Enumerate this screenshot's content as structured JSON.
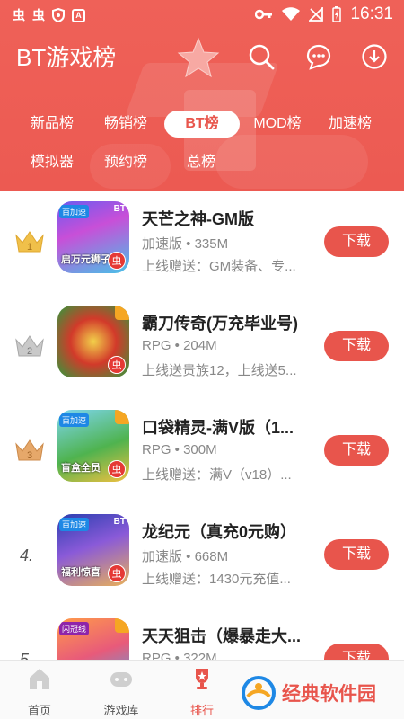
{
  "status_bar": {
    "time": "16:31",
    "left_glyphs": [
      "虫",
      "虫"
    ]
  },
  "header": {
    "title": "BT游戏榜"
  },
  "tabs_row1": [
    {
      "label": "新品榜",
      "active": false
    },
    {
      "label": "畅销榜",
      "active": false
    },
    {
      "label": "BT榜",
      "active": true
    },
    {
      "label": "MOD榜",
      "active": false
    },
    {
      "label": "加速榜",
      "active": false
    }
  ],
  "tabs_row2": [
    {
      "label": "模拟器",
      "active": false
    },
    {
      "label": "预约榜",
      "active": false
    },
    {
      "label": "总榜",
      "active": false
    }
  ],
  "games": [
    {
      "rank": "1",
      "name": "天芒之神-GM版",
      "meta": "加速版 • 335M",
      "note": "上线赠送：GM装备、专...",
      "button": "下载",
      "icon_caption": "启万元狮子",
      "icon_tag": "百加速"
    },
    {
      "rank": "2",
      "name": "霸刀传奇(万充毕业号)",
      "meta": "RPG • 204M",
      "note": "上线送贵族12，上线送5...",
      "button": "下载",
      "icon_caption": "",
      "icon_tag": ""
    },
    {
      "rank": "3",
      "name": "口袋精灵-满V版（1...",
      "meta": "RPG • 300M",
      "note": "上线赠送：满V（v18）...",
      "button": "下载",
      "icon_caption": "盲盒全员",
      "icon_tag": "百加速"
    },
    {
      "rank": "4.",
      "name": "龙纪元（真充0元购）",
      "meta": "加速版 • 668M",
      "note": "上线赠送：1430元充值...",
      "button": "下载",
      "icon_caption": "福利惊喜",
      "icon_tag": "百加速"
    },
    {
      "rank": "5",
      "name": "天天狙击（爆暴走大...",
      "meta": "RPG • 322M",
      "note": "",
      "button": "下载",
      "icon_caption": "",
      "icon_tag": "闪冠线"
    }
  ],
  "bottom_nav": [
    {
      "label": "首页",
      "active": false
    },
    {
      "label": "游戏库",
      "active": false
    },
    {
      "label": "排行",
      "active": true
    }
  ],
  "watermark": {
    "text": "经典软件园"
  },
  "colors": {
    "primary": "#e8554c",
    "header": "#ec5a52",
    "gold": "#e8b54a",
    "silver": "#b0b0b0",
    "bronze": "#d9975a"
  }
}
